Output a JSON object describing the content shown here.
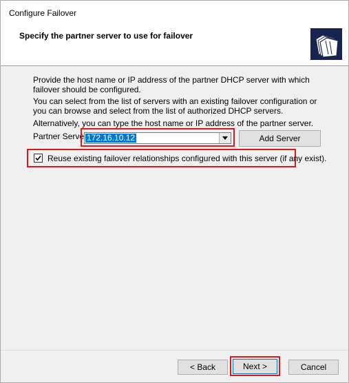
{
  "window": {
    "title": "Configure Failover"
  },
  "header": {
    "title": "Specify the partner server to use for failover",
    "icon": "folder-stack-icon"
  },
  "body": {
    "para1": "Provide the host name or IP address of the partner DHCP server with which failover should be configured.",
    "para2": "You can select from the list of servers with an existing failover configuration or you can browse and select from the list of authorized DHCP servers.",
    "para3": "Alternatively, you can type the host name or IP address of the partner server.",
    "partner_label": "Partner Server",
    "partner_value": "172.16.10.12",
    "add_server_label": "Add Server",
    "checkbox_label": "Reuse existing failover relationships configured with this server (if any exist).",
    "checkbox_checked": true
  },
  "footer": {
    "back_label": "< Back",
    "next_label": "Next >",
    "cancel_label": "Cancel"
  },
  "colors": {
    "highlight_border": "#e1151a",
    "selection": "#0078d7",
    "header_icon_bg": "#17244f"
  }
}
